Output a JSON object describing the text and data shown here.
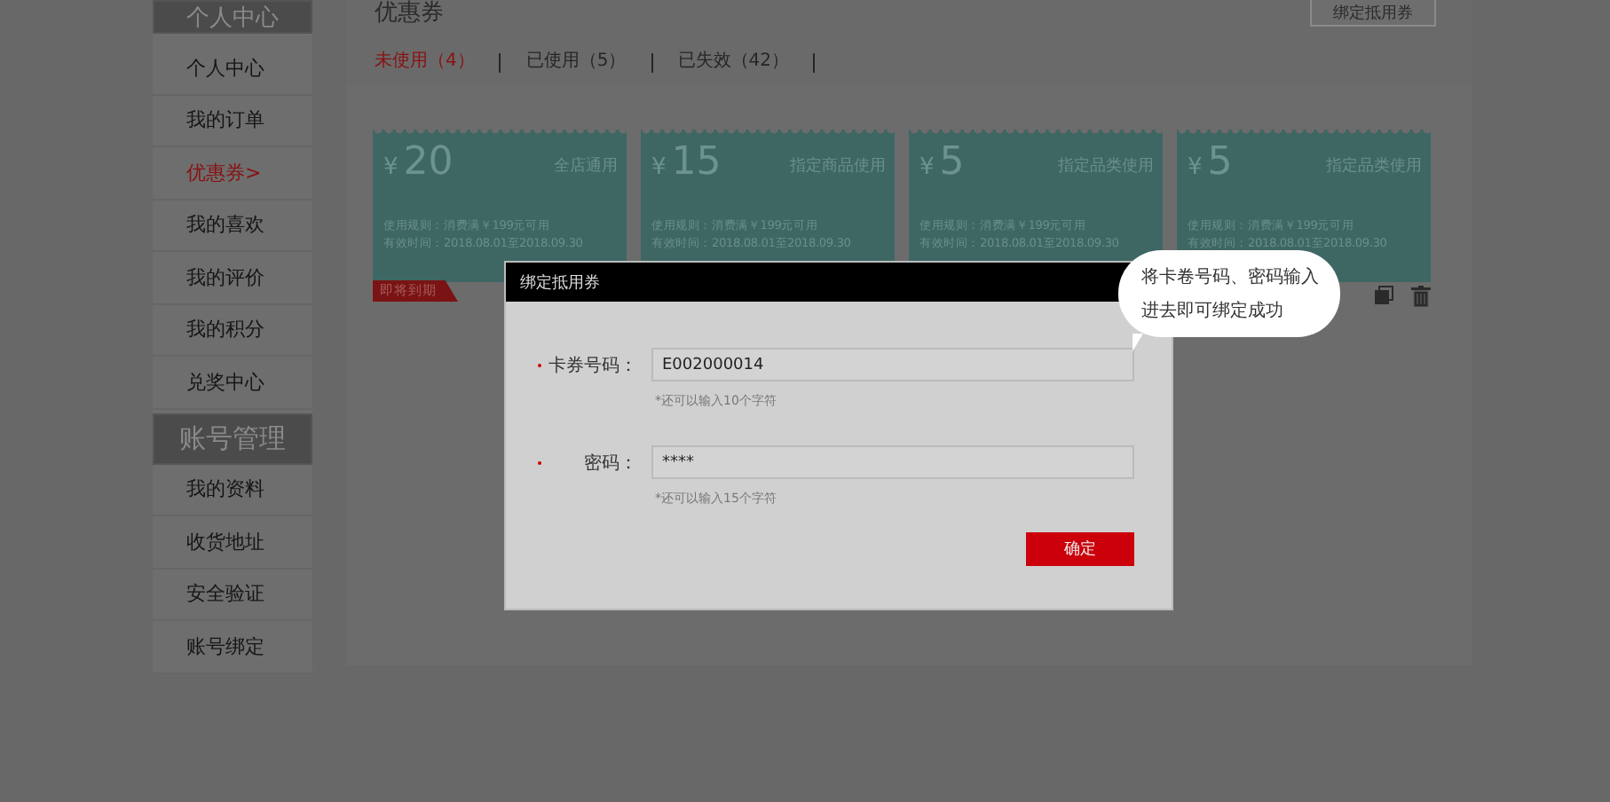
{
  "sidebar": {
    "sections": [
      {
        "title": "个人中心",
        "items": [
          {
            "label": "个人中心",
            "selected": false
          },
          {
            "label": "我的订单",
            "selected": false
          },
          {
            "label": "优惠券>",
            "selected": true
          },
          {
            "label": "我的喜欢",
            "selected": false
          },
          {
            "label": "我的评价",
            "selected": false
          },
          {
            "label": "我的积分",
            "selected": false
          },
          {
            "label": "兑奖中心",
            "selected": false
          }
        ]
      },
      {
        "title": "账号管理",
        "items": [
          {
            "label": "我的资料",
            "selected": false
          },
          {
            "label": "收货地址",
            "selected": false
          },
          {
            "label": "安全验证",
            "selected": false
          },
          {
            "label": "账号绑定",
            "selected": false
          }
        ]
      }
    ]
  },
  "panel": {
    "title": "优惠券",
    "bind_button": "绑定抵用券",
    "tabs": [
      {
        "label": "未使用（4）",
        "selected": true
      },
      {
        "label": "已使用（5）",
        "selected": false
      },
      {
        "label": "已失效（42）",
        "selected": false
      }
    ],
    "coupons": [
      {
        "currency": "¥",
        "amount": "20",
        "scope": "全店通用",
        "rule": "使用规则：消费满￥199元可用",
        "validity": "有效时间：2018.08.01至2018.09.30",
        "badge": "即将到期"
      },
      {
        "currency": "¥",
        "amount": "15",
        "scope": "指定商品使用",
        "rule": "使用规则：消费满￥199元可用",
        "validity": "有效时间：2018.08.01至2018.09.30"
      },
      {
        "currency": "¥",
        "amount": "5",
        "scope": "指定品类使用",
        "rule": "使用规则：消费满￥199元可用",
        "validity": "有效时间：2018.08.01至2018.09.30"
      },
      {
        "currency": "¥",
        "amount": "5",
        "scope": "指定品类使用",
        "rule": "使用规则：消费满￥199元可用",
        "validity": "有效时间：2018.08.01至2018.09.30"
      }
    ]
  },
  "dialog": {
    "title": "绑定抵用券",
    "fields": [
      {
        "label": "卡券号码：",
        "value": "E002000014",
        "hint": "*还可以输入10个字符",
        "required": true
      },
      {
        "label": "密码：",
        "value": "****",
        "hint": "*还可以输入15个字符",
        "required": true
      }
    ],
    "confirm": "确定"
  },
  "tip": {
    "lines": [
      "将卡卷号码、密码输入",
      "进去即可绑定成功"
    ]
  }
}
